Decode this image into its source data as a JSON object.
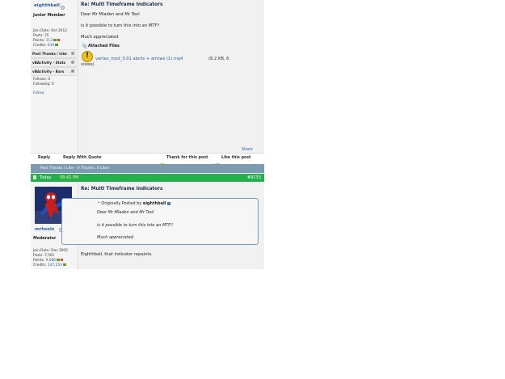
{
  "post1": {
    "username": "eighthball",
    "rank": "Junior Member",
    "join_date": "Join Date:  Oct 2012",
    "posts_label": "Posts:",
    "posts_value": "25",
    "points_label": "Points:",
    "points_value": "113",
    "credits_label": "Credits:",
    "credits_value": "630",
    "thanks_box": "Post Thanks / Like",
    "vb_stats_box": "vBActivity - Stats",
    "vb_bars_box": "vBActivity - Bars",
    "follows": "Follows:  0",
    "following": "Following:  0",
    "follow_link": "Follow",
    "title": "Re: Multi Timeframe Indicators",
    "line1": "Dear Mr Mladen and Mr Tool",
    "line2": "is it possible to turn this into an MTF?",
    "line3": "Much appreciated",
    "attached_files": "Attached Files",
    "file_name": "vertex_mod_3.01 alerts + arrows (1).mq4",
    "file_meta": "(8.2 KB, 6",
    "file_meta2": "views)",
    "share": "Share"
  },
  "actions": {
    "reply": "Reply",
    "reply_quote": "Reply With Quote",
    "thank": "Thank for this post",
    "like": "Like this post"
  },
  "thanks_bar": "Post Thanks / Like - 0 Thanks, 0 Likes",
  "post2": {
    "date": "Today",
    "time": "08:41 PM",
    "post_number": "#9733",
    "username": "mrtools",
    "rank": "Moderator",
    "join_date": "Join Date:  Dec 2005",
    "posts_label": "Posts:",
    "posts_value": "7,561",
    "points_label": "Points:",
    "points_value": "9,680",
    "credits_label": "Credits:",
    "credits_value": "147,253",
    "title": "Re: Multi Timeframe Indicators",
    "quote_prefix": "Originally Posted by",
    "quote_author": "eighthball",
    "quote_line1": "Dear Mr Mladen and Mr Tool",
    "quote_line2": "is it possible to turn this into an MTF?",
    "quote_line3": "Much appreciated",
    "reply_text": "Eighthball, that indicator repaints."
  }
}
